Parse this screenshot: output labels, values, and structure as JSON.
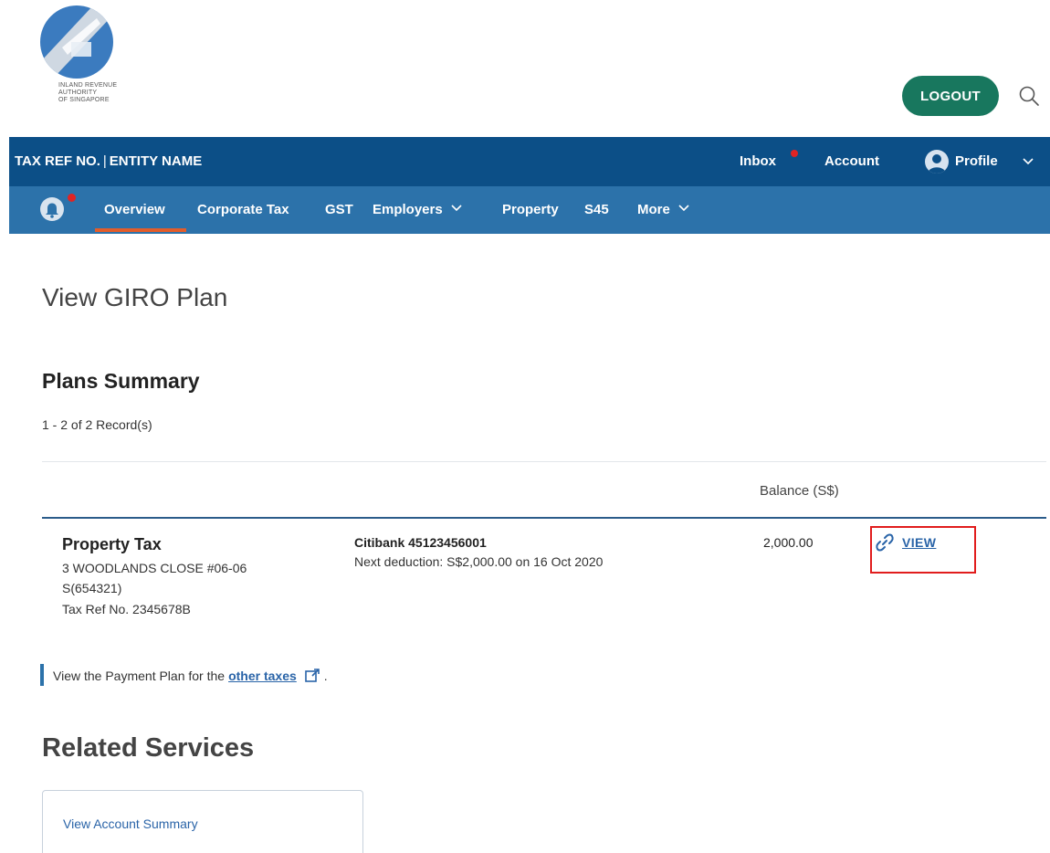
{
  "header": {
    "logo_lines": [
      "INLAND REVENUE",
      "AUTHORITY",
      "OF SINGAPORE"
    ],
    "logout_label": "LOGOUT"
  },
  "top_bar": {
    "tax_ref_label": "TAX REF NO.",
    "separator": "|",
    "entity_label": "ENTITY NAME",
    "inbox_label": "Inbox",
    "account_label": "Account",
    "profile_label": "Profile"
  },
  "nav": {
    "items": [
      {
        "label": "Overview"
      },
      {
        "label": "Corporate Tax"
      },
      {
        "label": "GST"
      },
      {
        "label": "Employers"
      },
      {
        "label": "Property"
      },
      {
        "label": "S45"
      },
      {
        "label": "More"
      }
    ]
  },
  "page": {
    "title": "View GIRO Plan",
    "section_title": "Plans Summary",
    "records": "1 - 2 of 2 Record(s)",
    "balance_header": "Balance (S$)"
  },
  "plan": {
    "tax_type": "Property Tax",
    "address_line1": "3 WOODLANDS CLOSE #06-06",
    "address_line2": "S(654321)",
    "tax_ref": "Tax Ref No. 2345678B",
    "bank": "Citibank 45123456001",
    "next_deduction": "Next deduction: S$2,000.00 on 16 Oct 2020",
    "balance": "2,000.00",
    "view_label": "VIEW"
  },
  "callout": {
    "prefix": "View the Payment Plan for the",
    "link": "other taxes",
    "suffix": "."
  },
  "related": {
    "title": "Related Services",
    "card_label": "View Account Summary"
  },
  "colors": {
    "top_bar": "#0c4f87",
    "nav_bar": "#2c72aa",
    "logout": "#18775e",
    "link": "#2a64a8",
    "highlight": "#e11d1d",
    "active_underline": "#e35d2b"
  }
}
